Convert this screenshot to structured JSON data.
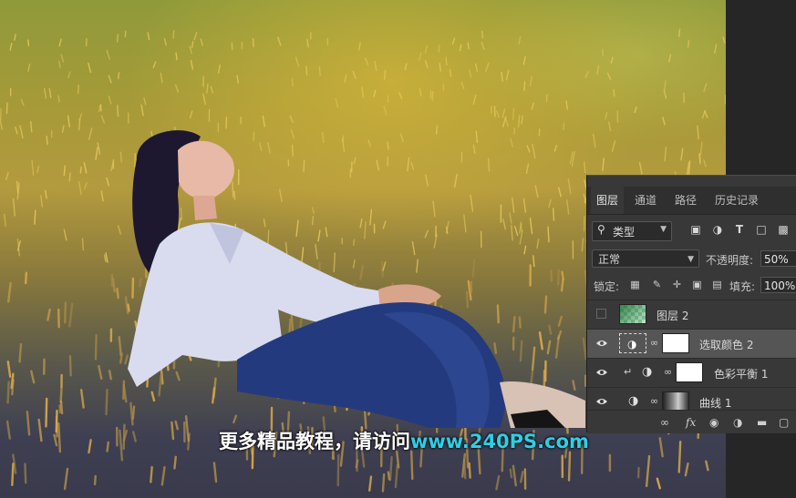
{
  "panel": {
    "tabs": [
      {
        "label": "图层",
        "active": true
      },
      {
        "label": "通道",
        "active": false
      },
      {
        "label": "路径",
        "active": false
      },
      {
        "label": "历史记录",
        "active": false
      }
    ],
    "filter": {
      "label": "类型",
      "icon": "search-icon"
    },
    "filter_icons": [
      "image-filter-icon",
      "adjustment-filter-icon",
      "type-filter-icon",
      "shape-filter-icon",
      "smart-object-filter-icon"
    ],
    "blend_mode": "正常",
    "opacity_label": "不透明度:",
    "opacity_value": "50%",
    "lock_label": "锁定:",
    "lock_icons": [
      "lock-transparent-icon",
      "lock-brush-icon",
      "lock-position-icon",
      "lock-artboard-icon",
      "lock-all-icon"
    ],
    "fill_label": "填充:",
    "fill_value": "100%",
    "layers": [
      {
        "name": "图层 2",
        "visible": false,
        "thumb": "gradient-checker",
        "selected": false
      },
      {
        "name": "选取颜色 2",
        "visible": true,
        "thumb": "selective-color",
        "selected": true
      },
      {
        "name": "色彩平衡 1",
        "visible": true,
        "thumb": "color-balance",
        "selected": false,
        "clipped": true
      },
      {
        "name": "曲线 1",
        "visible": true,
        "thumb": "curves",
        "selected": false
      }
    ],
    "bottom_icons": [
      "link-layers-icon",
      "fx-icon",
      "add-mask-icon",
      "new-adjustment-icon",
      "new-group-icon",
      "new-layer-icon",
      "delete-layer-icon"
    ],
    "fx_label": "fx"
  },
  "watermark": {
    "prefix": "更多精品教程，请访问",
    "site": "www.240PS.com"
  },
  "colors": {
    "panel_bg": "#383838",
    "selected_row": "#555555",
    "watermark_site": "#2ecfe6"
  }
}
